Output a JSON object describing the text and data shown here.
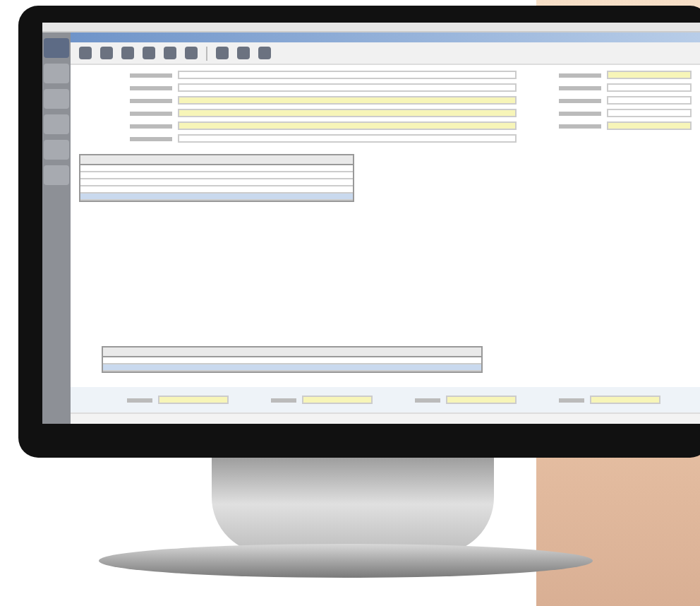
{
  "screen": {
    "sidebar_items": [
      {
        "selected": true
      },
      {
        "selected": false
      },
      {
        "selected": false
      },
      {
        "selected": false
      },
      {
        "selected": false
      },
      {
        "selected": false
      }
    ],
    "toolbar_buttons": [
      {
        "kind": "icon"
      },
      {
        "kind": "icon"
      },
      {
        "kind": "icon"
      },
      {
        "kind": "icon"
      },
      {
        "kind": "icon"
      },
      {
        "kind": "icon"
      },
      {
        "kind": "separator"
      },
      {
        "kind": "icon"
      },
      {
        "kind": "icon"
      },
      {
        "kind": "icon"
      }
    ],
    "form_fields": [
      {
        "highlighted": false
      },
      {
        "highlighted": false
      },
      {
        "highlighted": true
      },
      {
        "highlighted": true
      },
      {
        "highlighted": true
      },
      {
        "highlighted": false
      }
    ],
    "side_fields": [
      {
        "highlighted": true
      },
      {
        "highlighted": false
      },
      {
        "highlighted": false
      },
      {
        "highlighted": false
      },
      {
        "highlighted": true
      }
    ],
    "lines_rows": [
      {
        "selected": false
      },
      {
        "selected": false
      },
      {
        "selected": false
      },
      {
        "selected": false
      },
      {
        "selected": true
      }
    ],
    "bottom_rows": [
      {
        "selected": false
      },
      {
        "selected": true
      }
    ],
    "totals_fields": [
      {
        "highlighted": true
      },
      {
        "highlighted": true
      },
      {
        "highlighted": true
      },
      {
        "highlighted": true
      }
    ]
  }
}
